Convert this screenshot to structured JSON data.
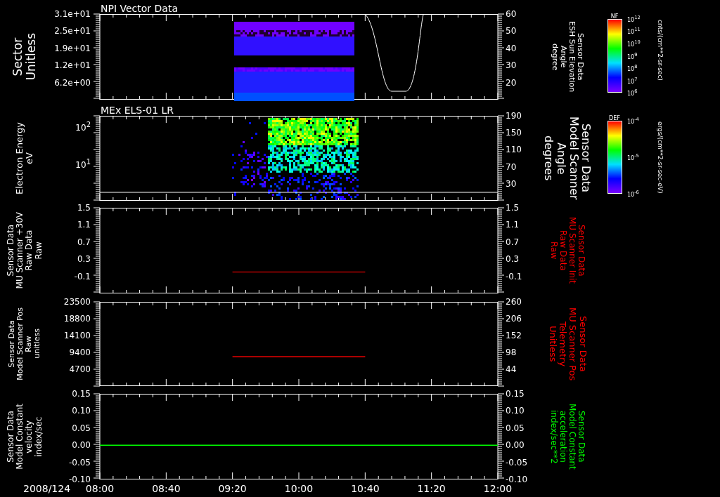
{
  "panels": [
    {
      "title": "NPI Vector Data",
      "kind": "sector",
      "left_label": [
        "Sector",
        "Unitless"
      ],
      "left_ticks": [
        "3.1e+01",
        "2.5e+01",
        "1.9e+01",
        "1.2e+01",
        "6.2e+00"
      ],
      "right_ticks": [
        "60",
        "50",
        "40",
        "30",
        "20"
      ],
      "right_label": [
        "Sensor Data",
        "ESH Sun Elevation",
        "Angle",
        "degree"
      ],
      "color": "#ffffff"
    },
    {
      "title": "MEx ELS-01 LR",
      "kind": "energy",
      "left_label": [
        "Electron Energy",
        "eV"
      ],
      "left_ticks": [
        "10$^{2}$",
        "10$^{1}$"
      ],
      "right_ticks": [
        "190",
        "150",
        "110",
        "70",
        "30"
      ],
      "right_label": [
        "Sensor Data",
        "Model Scanner",
        "Angle",
        "degrees"
      ],
      "color": "#ffffff"
    },
    {
      "kind": "line",
      "left_label": [
        "Sensor Data",
        "MU Scanner +30V",
        "Raw Data",
        "Raw"
      ],
      "right_ticks": [
        "1.5",
        "1.1",
        "0.7",
        "0.3",
        "-0.1"
      ],
      "right_label": [
        "Sensor Data",
        "MU Scanner Init",
        "Raw Data",
        "Raw"
      ],
      "color": "#ff0000",
      "chart_data": {
        "type": "line",
        "x": [
          9.333,
          10.667
        ],
        "xlim": [
          8,
          12
        ],
        "ylim": [
          -0.5,
          1.5
        ],
        "yticks": [
          {
            "value": 1.5,
            "label": "1.5"
          },
          {
            "value": 1.1,
            "label": "1.1"
          },
          {
            "value": 0.7,
            "label": "0.7"
          },
          {
            "value": 0.3,
            "label": "0.3"
          },
          {
            "value": -0.1,
            "label": "-0.1"
          }
        ],
        "series": [
          {
            "color": "#b00000",
            "values": [
              0.0,
              0.0
            ]
          }
        ]
      }
    },
    {
      "kind": "line",
      "left_label": [
        "Sensor Data",
        "Model Scanner Pos",
        "Raw",
        "unitless"
      ],
      "right_ticks": [
        "260",
        "206",
        "152",
        "98",
        "44"
      ],
      "right_label": [
        "Sensor Data",
        "MU Scanner Pos",
        "Telemetry",
        "Unitless"
      ],
      "color": "#ff0000",
      "chart_data": {
        "type": "line",
        "x": [
          9.333,
          10.667
        ],
        "xlim": [
          8,
          12
        ],
        "ylim": [
          0,
          23500
        ],
        "yticks": [
          {
            "value": 23500,
            "label": "23500"
          },
          {
            "value": 18800,
            "label": "18800"
          },
          {
            "value": 14100,
            "label": "14100"
          },
          {
            "value": 9400,
            "label": "9400"
          },
          {
            "value": 4700,
            "label": "4700"
          }
        ],
        "series": [
          {
            "color": "#ff0000",
            "values": [
              8200,
              8200
            ]
          }
        ]
      }
    },
    {
      "kind": "line",
      "left_label": [
        "Sensor Data",
        "Model Constant",
        "velocity",
        "index/sec"
      ],
      "right_ticks": [
        "0.15",
        "0.10",
        "0.05",
        "0.00",
        "-0.05",
        "-0.10"
      ],
      "right_label": [
        "Sensor Data",
        "Model Constant",
        "acceleration",
        "index/sec**2"
      ],
      "color": "#00ff00",
      "chart_data": {
        "type": "line",
        "x": [
          8,
          12
        ],
        "xlim": [
          8,
          12
        ],
        "ylim": [
          -0.1,
          0.15
        ],
        "yticks": [
          {
            "value": 0.15,
            "label": "0.15"
          },
          {
            "value": 0.1,
            "label": "0.10"
          },
          {
            "value": 0.05,
            "label": "0.05"
          },
          {
            "value": 0,
            "label": "0.00"
          },
          {
            "value": -0.05,
            "label": "-0.05"
          },
          {
            "value": -0.1,
            "label": "-0.10"
          }
        ],
        "xticks": [
          {
            "value": 8,
            "label": "08:00"
          },
          {
            "value": 8.667,
            "label": "08:40"
          },
          {
            "value": 9.333,
            "label": "09:20"
          },
          {
            "value": 10,
            "label": "10:00"
          },
          {
            "value": 10.667,
            "label": "10:40"
          },
          {
            "value": 11.333,
            "label": "11:20"
          },
          {
            "value": 12,
            "label": "12:00"
          }
        ],
        "series": [
          {
            "color": "#00ff00",
            "values": [
              0.0,
              0.0
            ]
          }
        ]
      }
    }
  ],
  "colorbars": [
    {
      "label": "NF",
      "ticks": [
        "10$^{12}$",
        "10$^{11}$",
        "10$^{10}$",
        "10$^{9}$",
        "10$^{8}$",
        "10$^{7}$",
        "10$^{6}$"
      ],
      "units": "cnts/(cm**2-sr-sec)"
    },
    {
      "label": "DEF",
      "ticks": [
        "10$^{-4}$",
        "10$^{-5}$",
        "10$^{-6}$"
      ],
      "units": "ergs/(cm**2-sr-sec-eV)"
    }
  ],
  "date": "2008/124"
}
